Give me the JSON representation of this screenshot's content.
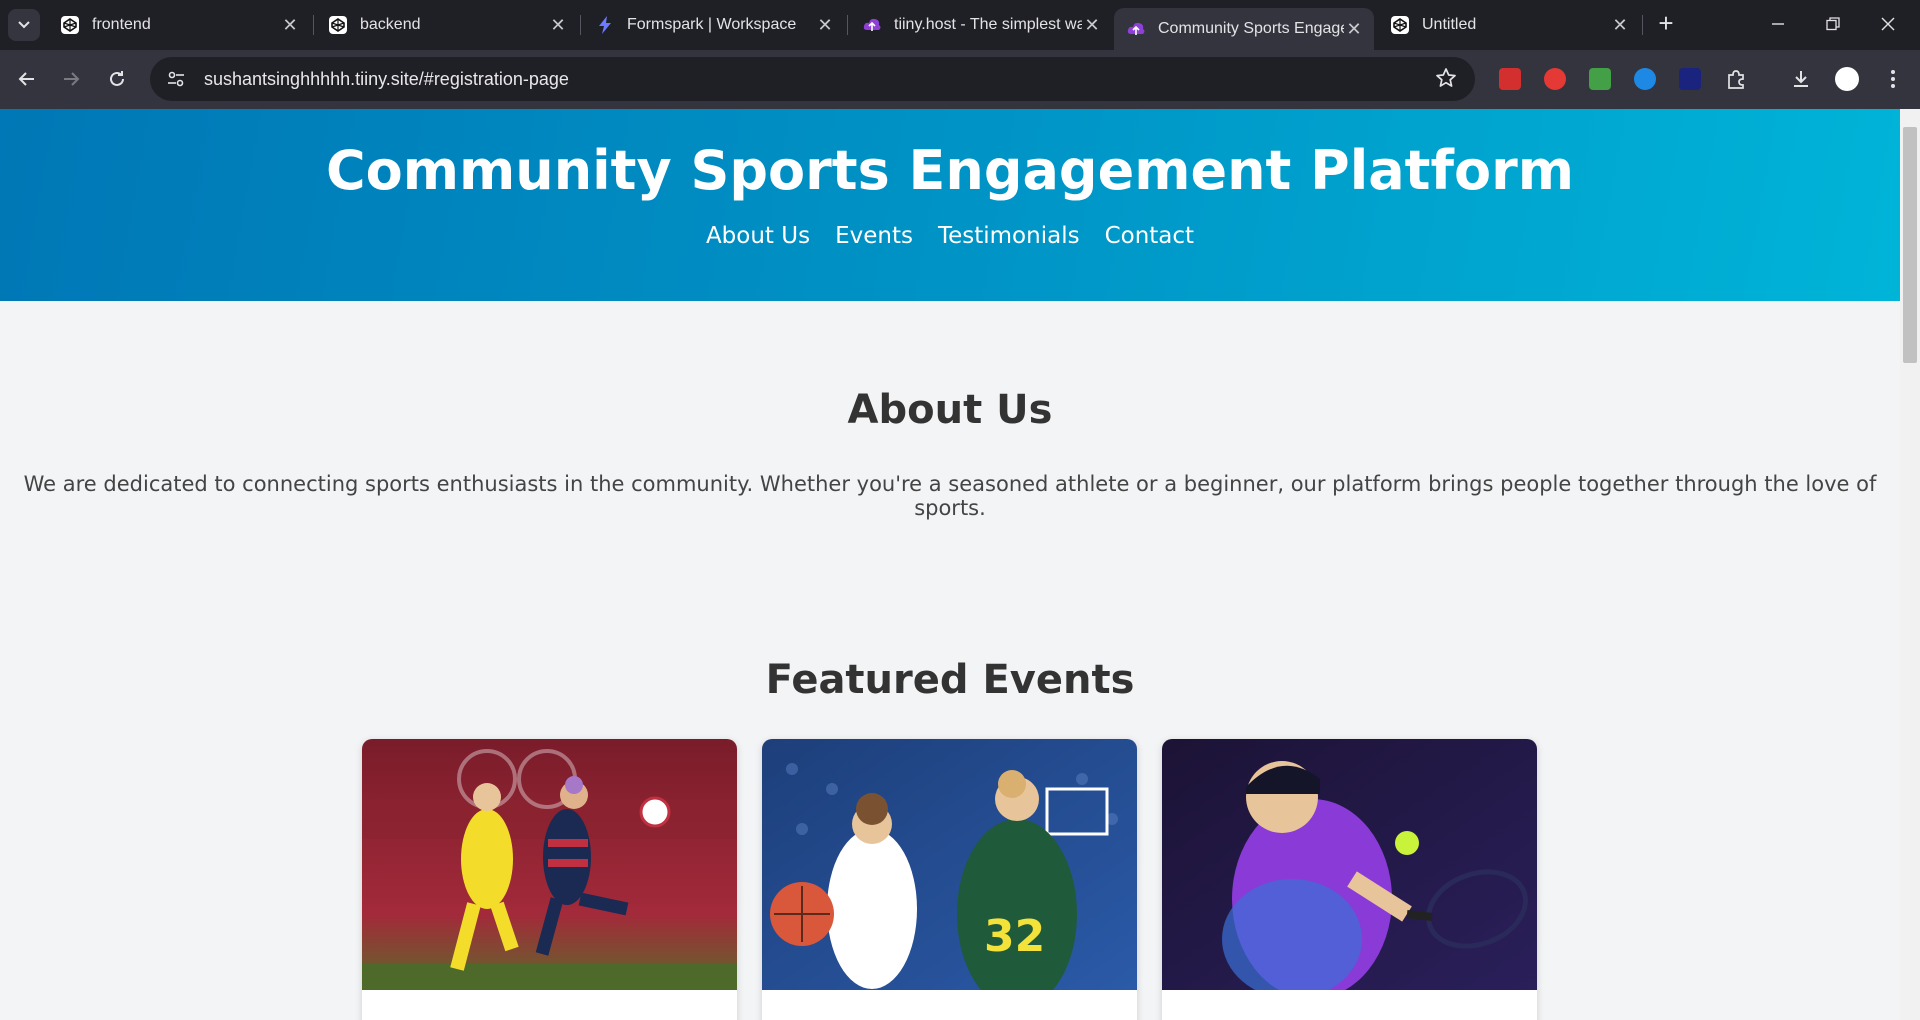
{
  "tabs": [
    {
      "title": "frontend",
      "favicon": "codepen-icon",
      "active": false
    },
    {
      "title": "backend",
      "favicon": "codepen-icon",
      "active": false
    },
    {
      "title": "Formspark | Workspace",
      "favicon": "bolt-icon",
      "active": false
    },
    {
      "title": "tiiny.host - The simplest wa",
      "favicon": "cloud-icon",
      "active": false
    },
    {
      "title": "Community Sports Engage",
      "favicon": "cloud-icon",
      "active": true
    },
    {
      "title": "Untitled",
      "favicon": "codepen-icon",
      "active": false
    }
  ],
  "toolbar": {
    "url": "sushantsinghhhhh.tiiny.site/#registration-page"
  },
  "extensions": [
    {
      "name": "red-video-extension-icon",
      "color": "#d32f2f"
    },
    {
      "name": "adblock-extension-icon",
      "color": "#e53935"
    },
    {
      "name": "green-sheet-extension-icon",
      "color": "#43a047"
    },
    {
      "name": "blue-circle-extension-icon",
      "color": "#1e88e5"
    },
    {
      "name": "chart-extension-icon",
      "color": "#1a237e"
    }
  ],
  "page": {
    "title": "Community Sports Engagement Platform",
    "nav": [
      "About Us",
      "Events",
      "Testimonials",
      "Contact"
    ],
    "about_heading": "About Us",
    "about_text": "We are dedicated to connecting sports enthusiasts in the community. Whether you're a seasoned athlete or a beginner, our platform brings people together through the love of sports.",
    "events_heading": "Featured Events",
    "events": [
      {
        "image": "soccer-players-photo"
      },
      {
        "image": "basketball-players-photo"
      },
      {
        "image": "tennis-player-photo"
      }
    ]
  },
  "colors": {
    "hero_start": "#0077b6",
    "hero_end": "#00b4d8",
    "page_bg": "#f3f4f6",
    "heading": "#333333"
  }
}
